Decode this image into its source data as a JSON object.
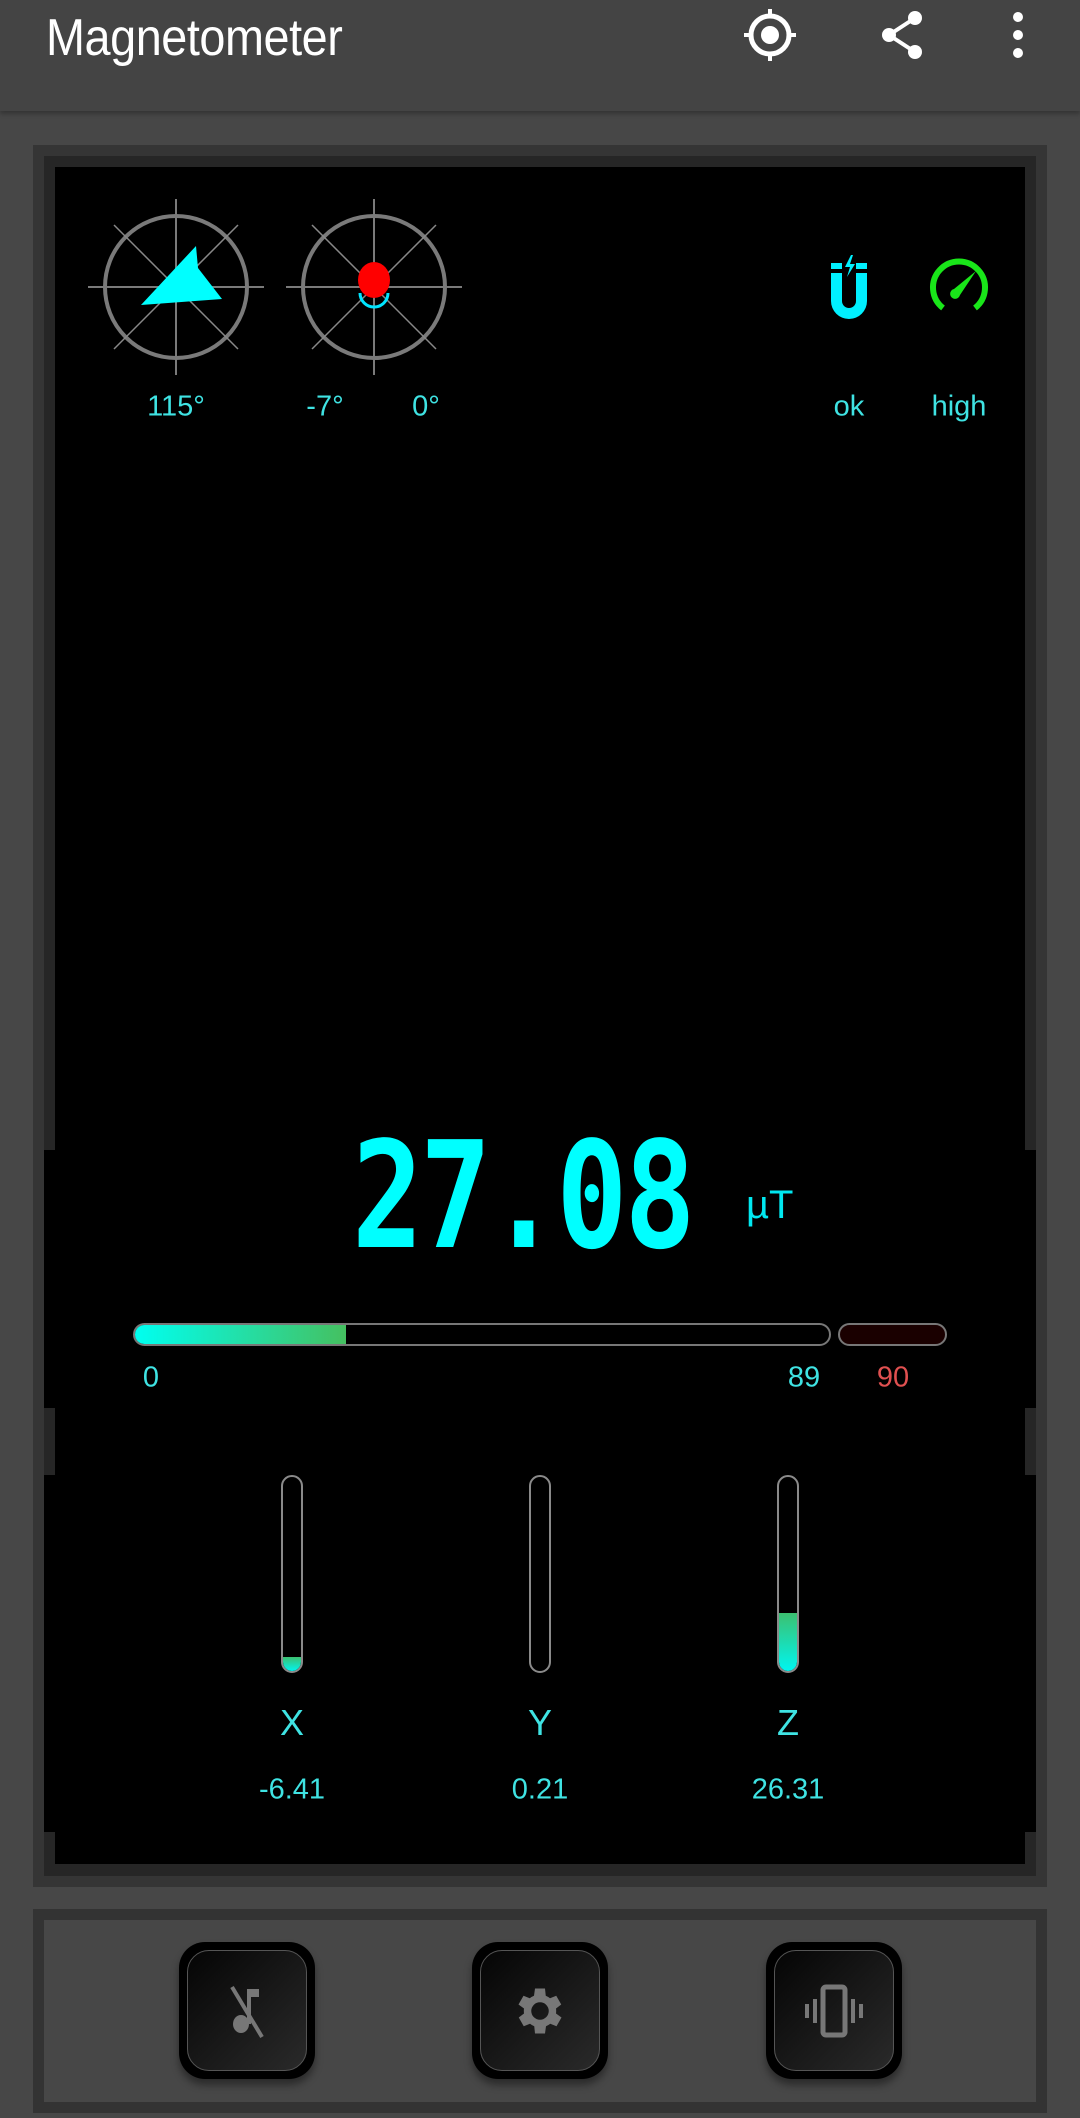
{
  "app": {
    "title": "Magnetometer"
  },
  "toolbar": {
    "icons": [
      "gps-target-icon",
      "share-icon",
      "more-vert-icon"
    ]
  },
  "compass": {
    "heading": "115°",
    "pitch": "-7°",
    "roll": "0°"
  },
  "status": {
    "calibration": "ok",
    "accuracy": "high",
    "calibration_icon": "magnet-icon",
    "accuracy_icon": "speedometer-icon",
    "accuracy_color": "#19e619"
  },
  "reading": {
    "value": "27.08",
    "unit": "µT"
  },
  "range_bar": {
    "min": "0",
    "max": "89",
    "overflow": "90",
    "value": 27.08,
    "max_value": 89
  },
  "axes": [
    {
      "label": "X",
      "value": "-6.41",
      "fill": 0.07
    },
    {
      "label": "Y",
      "value": "0.21",
      "fill": 0
    },
    {
      "label": "Z",
      "value": "26.31",
      "fill": 0.3
    }
  ],
  "colors": {
    "accent": "#00ffff",
    "alarm": "#e05050",
    "dot": "#ff0000"
  },
  "bottom_buttons": [
    "music-off-icon",
    "gear-icon",
    "vibrate-icon"
  ]
}
